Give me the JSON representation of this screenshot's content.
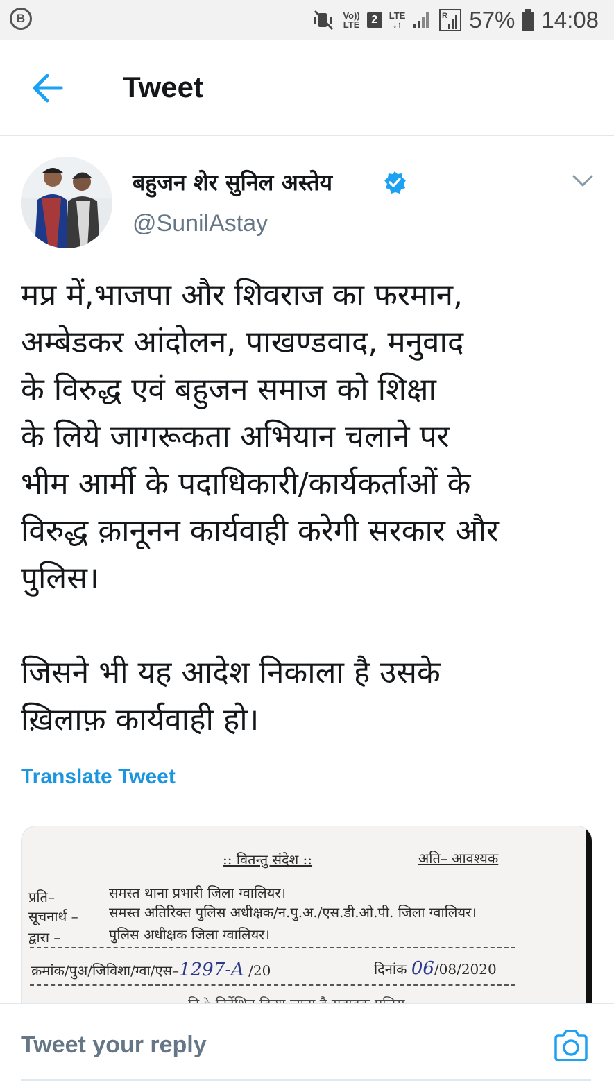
{
  "status_bar": {
    "app_badge": "B",
    "volte_top": "Vo))",
    "volte_bottom": "LTE",
    "sim": "2",
    "lte": "LTE",
    "battery": "57%",
    "time": "14:08"
  },
  "header": {
    "title": "Tweet",
    "back_icon": "arrow-left-icon"
  },
  "tweet": {
    "author_name": "बहुजन शेर सुनिल अस्तेय",
    "handle": "@SunilAstay",
    "verified": true,
    "text_paragraph_1": "मप्र में,भाजपा और शिवराज का फरमान,\nअम्बेडकर आंदोलन, पाखण्डवाद, मनुवाद\nके विरुद्ध एवं बहुजन समाज को शिक्षा\nके लिये जागरूकता अभियान चलाने पर\nभीम आर्मी के पदाधिकारी/कार्यकर्ताओं के\nविरुद्ध क़ानूनन कार्यवाही करेगी सरकार और\nपुलिस।",
    "text_paragraph_2": "जिसने भी यह आदेश निकाला है उसके\nख़िलाफ़ कार्यवाही हो।",
    "translate_label": "Translate Tweet"
  },
  "media_document": {
    "heading": ":: वितन्तु संदेश ::",
    "urgent": "अति– आवश्यक",
    "to_label": "प्रति–",
    "to_value": "समस्त थाना प्रभारी जिला ग्वालियर।",
    "info_label": "सूचनार्थ –",
    "info_value": "समस्त अतिरिक्त पुलिस अधीक्षक/न.पु.अ./एस.डी.ओ.पी. जिला ग्वालियर।",
    "by_label": "द्वारा –",
    "by_value": "पुलिस अधीक्षक जिला ग्वालियर।",
    "ref_prefix": "क्रमांक/पुअ/जिविशा/ग्वा/एस–",
    "ref_handwritten": "1297-A",
    "ref_suffix": "/20",
    "date_label": "दिनांक",
    "date_handwritten": "06",
    "date_rest": "/08/2020",
    "cut_line": "नि    े निर्देशित किया जाता है सवाहक पुलिस"
  },
  "reply": {
    "placeholder": "Tweet your reply",
    "camera_icon": "camera-icon"
  },
  "colors": {
    "accent": "#1da1f2",
    "link": "#1b95e0",
    "muted": "#657786",
    "text": "#14171a"
  }
}
